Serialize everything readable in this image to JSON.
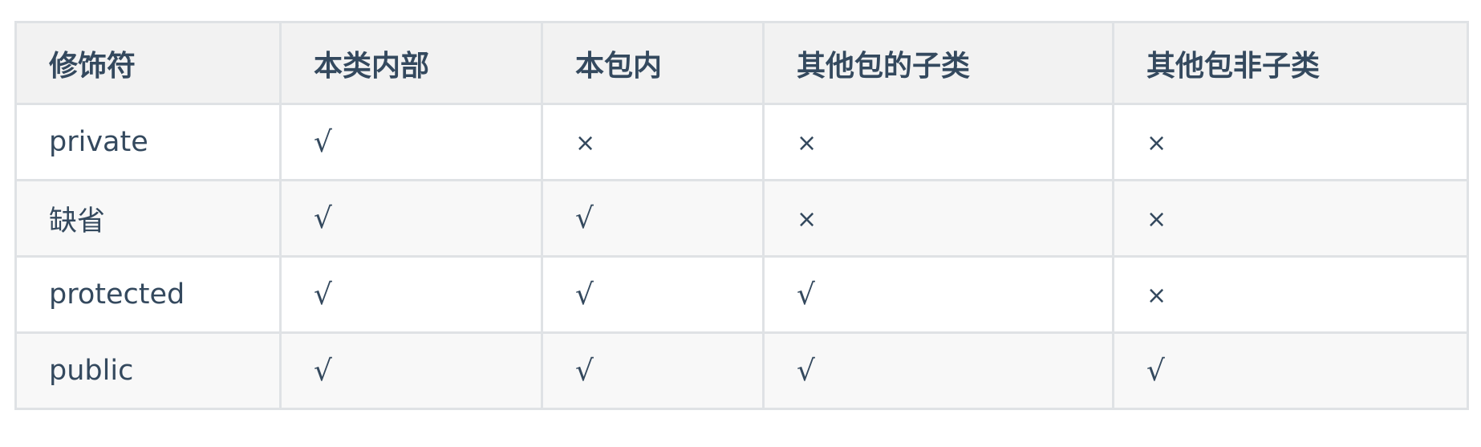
{
  "table": {
    "headers": [
      "修饰符",
      "本类内部",
      "本包内",
      "其他包的子类",
      "其他包非子类"
    ],
    "rows": [
      {
        "modifier": "private",
        "cells": [
          "√",
          "×",
          "×",
          "×"
        ]
      },
      {
        "modifier": "缺省",
        "cells": [
          "√",
          "√",
          "×",
          "×"
        ]
      },
      {
        "modifier": "protected",
        "cells": [
          "√",
          "√",
          "√",
          "×"
        ]
      },
      {
        "modifier": "public",
        "cells": [
          "√",
          "√",
          "√",
          "√"
        ]
      }
    ]
  }
}
